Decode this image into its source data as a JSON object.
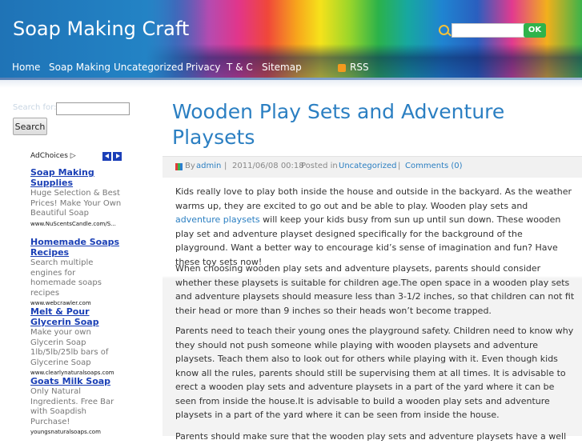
{
  "site": {
    "title": "Soap Making Craft",
    "search_button": "OK",
    "search_placeholder": ""
  },
  "nav": {
    "items": [
      "Home",
      "Soap Making",
      "Uncategorized",
      "Privacy",
      "T & C",
      "Sitemap"
    ],
    "rss": "RSS"
  },
  "sidebar": {
    "search_label": "Search for:",
    "search_value": "",
    "search_button": "Search",
    "adchoices": "AdChoices",
    "ads": [
      {
        "title": "Soap Making Supplies",
        "desc": "Huge Selection & Best Prices! Make Your Own Beautiful Soap",
        "url": "www.NuScentsCandle.com/S..."
      },
      {
        "title": "Homemade Soaps Recipes",
        "desc": "Search multiple engines for homemade soaps recipes",
        "url": "www.webcrawler.com"
      },
      {
        "title": "Melt & Pour Glycerin Soap",
        "desc": "Make your own Glycerin Soap 1lb/5lb/25lb bars of Glycerine Soap",
        "url": "www.clearlynaturalsoaps.com"
      },
      {
        "title": "Goats Milk Soap",
        "desc": "Only Natural Ingredients. Free Bar with Soapdish Purchase!",
        "url": "youngsnaturalsoaps.com"
      }
    ]
  },
  "post": {
    "title": "Wooden Play Sets and Adventure Playsets",
    "meta": {
      "by": "By",
      "author": "admin",
      "sep1": "|",
      "date": "2011/06/08 00:18",
      "posted_in": "Posted in",
      "category": "Uncategorized",
      "sep2": "|",
      "comments": "Comments (0)"
    },
    "p1_before": "Kids really love to play both inside the house and outside in the backyard. As the weather warms up, they are excited to go out and be able to play. Wooden play sets and ",
    "p1_link": "adventure playsets",
    "p1_after": " will keep your kids busy from sun up until sun down. These wooden play set and adventure playset designed specifically for the background of the playground. Want a better way to encourage kid’s sense of imagination and fun? Have these toy sets now!",
    "p2": "When choosing wooden play sets and  adventure playsets, parents should consider whether these playsets is suitable for children age.The open space in a wooden play sets and adventure playsets should measure less than 3-1/2 inches, so that children can not fit their head or more than 9 inches so their heads won’t  become trapped.",
    "p3": "Parents need to teach their young ones the playground safety. Children need to know why they should not push someone while playing with wooden playsets and adventure playsets. Teach them also to look out for others while playing with it. Even though kids know all the rules, parents should still be supervising them at all times. It is advisable to erect a wooden play sets and adventure playsets in a part of the yard where it can be seen from inside the house.It is advisable to build a wooden play sets and adventure playsets in a part of the yard where it can be seen from inside the house.",
    "p4": "Parents should make sure that the wooden play sets and adventure playsets have a well"
  }
}
